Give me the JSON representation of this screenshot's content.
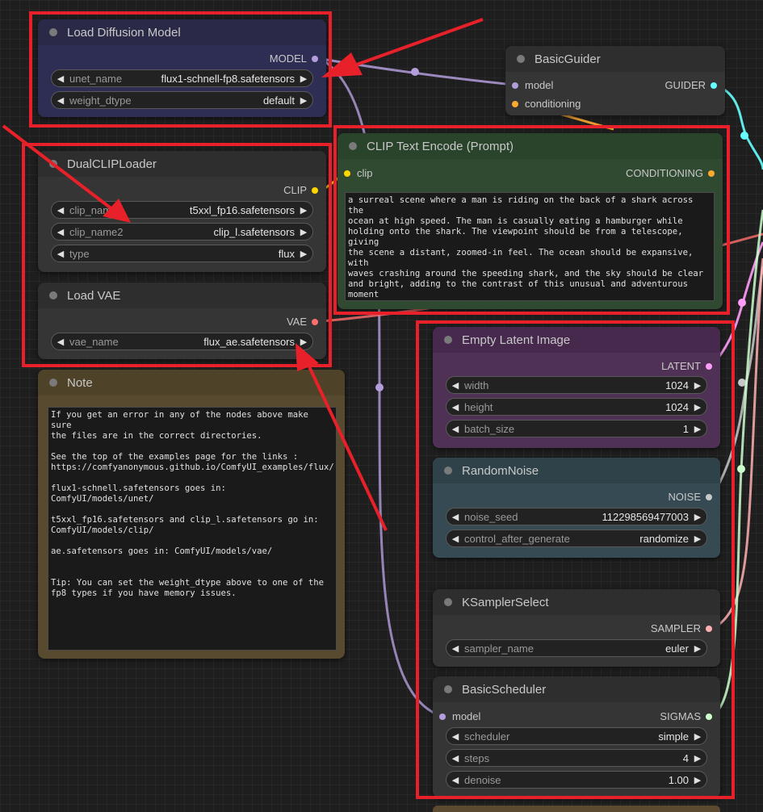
{
  "colors": {
    "model": "#b39ddb",
    "clip": "#ffd500",
    "vae": "#ff6e6e",
    "conditioning": "#ffa931",
    "guider": "#66ffff",
    "latent": "#ff9cf9",
    "noise": "#b0b0b0",
    "sampler": "#ffb0b0",
    "sigmas": "#cdffcd",
    "annotation": "#e8202a"
  },
  "load_diffusion_model": {
    "title": "Load Diffusion Model",
    "output": "MODEL",
    "unet_name": {
      "label": "unet_name",
      "value": "flux1-schnell-fp8.safetensors"
    },
    "weight_dtype": {
      "label": "weight_dtype",
      "value": "default"
    }
  },
  "dual_clip_loader": {
    "title": "DualCLIPLoader",
    "output": "CLIP",
    "clip_name1": {
      "label": "clip_nam",
      "value": "t5xxl_fp16.safetensors"
    },
    "clip_name2": {
      "label": "clip_name2",
      "value": "clip_l.safetensors"
    },
    "type": {
      "label": "type",
      "value": "flux"
    }
  },
  "load_vae": {
    "title": "Load VAE",
    "output": "VAE",
    "vae_name": {
      "label": "vae_name",
      "value": "flux_ae.safetensors"
    }
  },
  "note": {
    "title": "Note",
    "text": "If you get an error in any of the nodes above make sure\nthe files are in the correct directories.\n\nSee the top of the examples page for the links :\nhttps://comfyanonymous.github.io/ComfyUI_examples/flux/\n\nflux1-schnell.safetensors goes in: ComfyUI/models/unet/\n\nt5xxl_fp16.safetensors and clip_l.safetensors go in:\nComfyUI/models/clip/\n\nae.safetensors goes in: ComfyUI/models/vae/\n\n\nTip: You can set the weight_dtype above to one of the\nfp8 types if you have memory issues."
  },
  "basic_guider": {
    "title": "BasicGuider",
    "input_model": "model",
    "input_conditioning": "conditioning",
    "output": "GUIDER"
  },
  "clip_text_encode": {
    "title": "CLIP Text Encode (Prompt)",
    "input": "clip",
    "output": "CONDITIONING",
    "text": "a surreal scene where a man is riding on the back of a shark across the\nocean at high speed. The man is casually eating a hamburger while\nholding onto the shark. The viewpoint should be from a telescope, giving\nthe scene a distant, zoomed-in feel. The ocean should be expansive, with\nwaves crashing around the speeding shark, and the sky should be clear\nand bright, adding to the contrast of this unusual and adventurous\nmoment"
  },
  "empty_latent": {
    "title": "Empty Latent Image",
    "output": "LATENT",
    "width": {
      "label": "width",
      "value": "1024"
    },
    "height": {
      "label": "height",
      "value": "1024"
    },
    "batch_size": {
      "label": "batch_size",
      "value": "1"
    }
  },
  "random_noise": {
    "title": "RandomNoise",
    "output": "NOISE",
    "noise_seed": {
      "label": "noise_seed",
      "value": "112298569477003"
    },
    "control_after_generate": {
      "label": "control_after_generate",
      "value": "randomize"
    }
  },
  "ksampler_select": {
    "title": "KSamplerSelect",
    "output": "SAMPLER",
    "sampler_name": {
      "label": "sampler_name",
      "value": "euler"
    }
  },
  "basic_scheduler": {
    "title": "BasicScheduler",
    "input_model": "model",
    "output": "SIGMAS",
    "scheduler": {
      "label": "scheduler",
      "value": "simple"
    },
    "steps": {
      "label": "steps",
      "value": "4"
    },
    "denoise": {
      "label": "denoise",
      "value": "1.00"
    }
  }
}
